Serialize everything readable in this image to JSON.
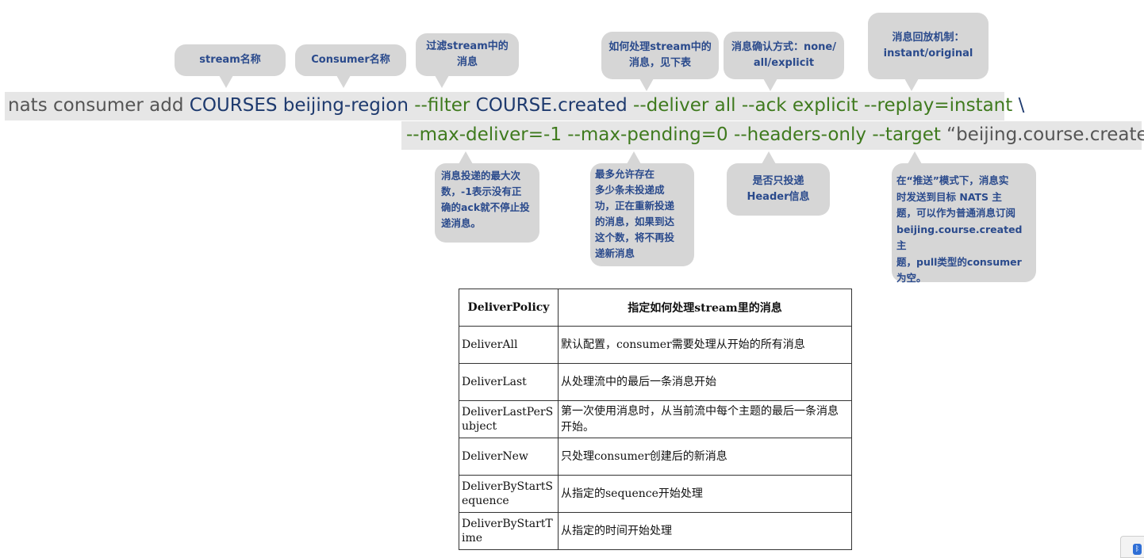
{
  "command": {
    "line1": {
      "base": "nats consumer add ",
      "stream": "COURSES",
      "consumer": "beijing-region",
      "filter_flag": "--filter",
      "filter_value": "COURSE.created",
      "deliver_flag": "--deliver all",
      "ack_flag": "--ack explicit",
      "replay_flag": "--replay=instant",
      "continuation": "\\"
    },
    "line2": {
      "max_deliver": "--max-deliver=-1",
      "max_pending": "--max-pending=0",
      "headers_only": "--headers-only",
      "target_flag": "--target",
      "target_value": "“beijing.course.created”"
    }
  },
  "callouts_top": [
    {
      "text": "stream名称"
    },
    {
      "text": "Consumer名称"
    },
    {
      "text": "过滤stream中的\n消息"
    },
    {
      "text": "如何处理stream中的\n消息，见下表"
    },
    {
      "text": "消息确认方式：none/\nall/explicit"
    },
    {
      "text": "消息回放机制：\ninstant/original"
    }
  ],
  "callouts_bottom": [
    {
      "text": "消息投递的最大次\n数，-1表示没有正\n确的ack就不停止投\n递消息。"
    },
    {
      "text": "最多允许存在\n多少条未投递成\n功，正在重新投递\n的消息，如果到达\n这个数，将不再投\n递新消息"
    },
    {
      "text": "是否只投递\nHeader信息"
    },
    {
      "text": "在“推送”模式下，消息实\n时发送到目标 NATS 主\n题，可以作为普通消息订阅\nbeijing.course.created主\n题，pull类型的consumer\n为空。"
    }
  ],
  "table": {
    "headers": [
      "DeliverPolicy",
      "指定如何处理stream里的消息"
    ],
    "rows": [
      [
        "DeliverAll",
        "默认配置，consumer需要处理从开始的所有消息"
      ],
      [
        "DeliverLast",
        "从处理流中的最后一条消息开始"
      ],
      [
        "DeliverLastPerSubject",
        "第一次使用消息时，从当前流中每个主题的最后一条消息开始。"
      ],
      [
        "DeliverNew",
        "只处理consumer创建后的新消息"
      ],
      [
        "DeliverByStartSequence",
        "从指定的sequence开始处理"
      ],
      [
        "DeliverByStartTime",
        "从指定的时间开始处理"
      ]
    ]
  },
  "colors": {
    "command_base": "#555555",
    "command_names": "#1e3a6e",
    "command_flags": "#3f7a1e",
    "callout_text": "#2a4a8c",
    "callout_bg": "#d6d6d6"
  },
  "icons": {
    "corner": "bluetooth-icon"
  }
}
